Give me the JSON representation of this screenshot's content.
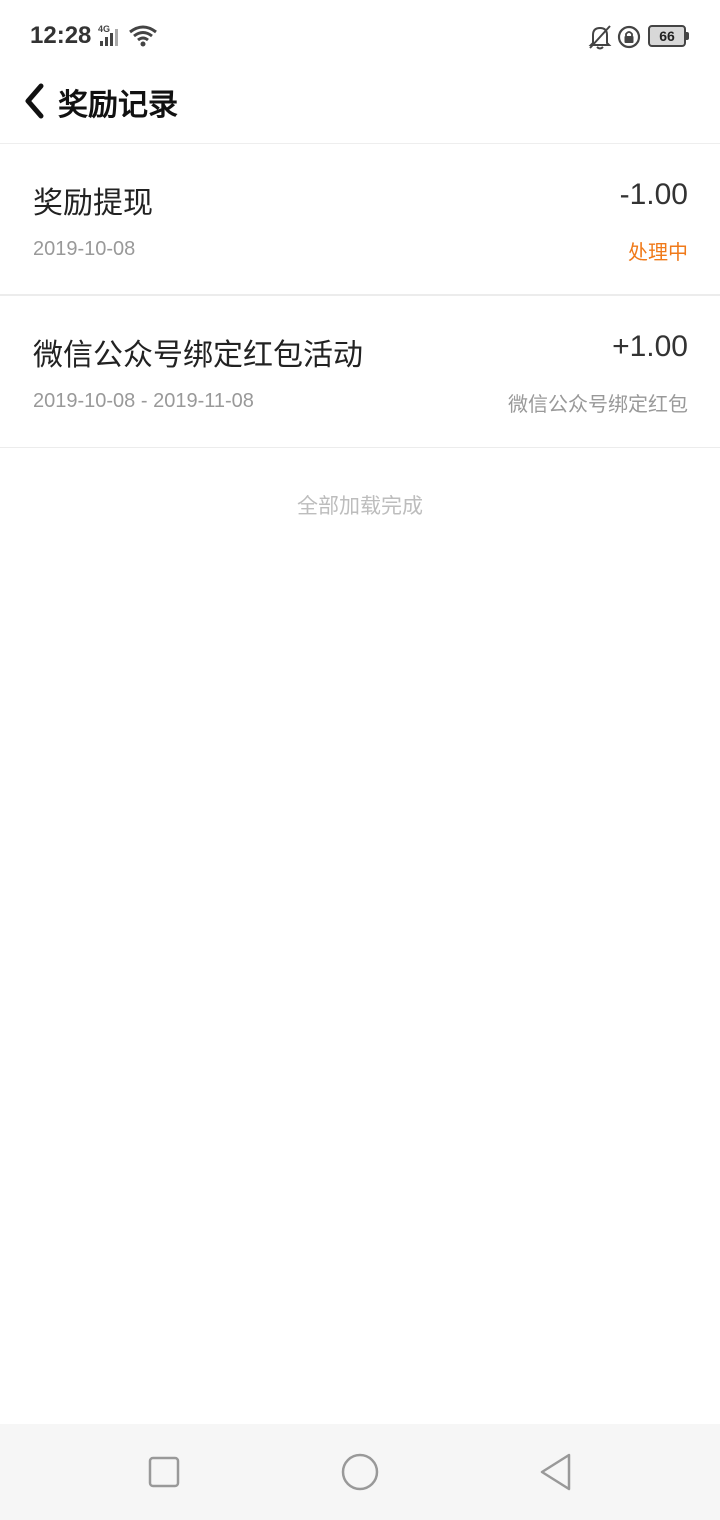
{
  "status_bar": {
    "time": "12:28",
    "network": "4G",
    "battery": "66"
  },
  "header": {
    "title": "奖励记录",
    "back_icon": "chevron-left-icon"
  },
  "records": [
    {
      "title": "奖励提现",
      "amount": "-1.00",
      "date": "2019-10-08",
      "status": "处理中",
      "status_color": "#f07a1a"
    },
    {
      "title": "微信公众号绑定红包活动",
      "amount": "+1.00",
      "date": "2019-10-08 - 2019-11-08",
      "status": "微信公众号绑定红包",
      "status_color": "#999999"
    }
  ],
  "footer_text": "全部加载完成",
  "nav_bar": {
    "recent_icon": "square-icon",
    "home_icon": "circle-icon",
    "back_icon": "triangle-back-icon"
  }
}
